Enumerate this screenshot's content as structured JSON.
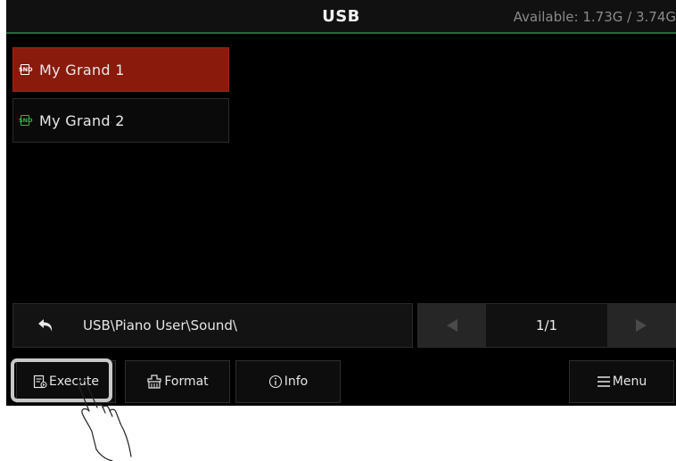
{
  "header": {
    "title": "USB",
    "available": "Available: 1.73G / 3.74G"
  },
  "files": [
    {
      "label": "My Grand 1",
      "tag": "SND",
      "selected": true
    },
    {
      "label": "My Grand 2",
      "tag": "SND",
      "selected": false
    }
  ],
  "path": {
    "value": "USB\\Piano User\\Sound\\"
  },
  "pager": {
    "page": "1/1"
  },
  "buttons": {
    "execute": "Execute",
    "format": "Format",
    "info": "Info",
    "menu": "Menu"
  },
  "colors": {
    "selected": "#8a1a0c",
    "accent_line": "#1f6b3a",
    "snd_icon_selected": "#ffffff",
    "snd_icon": "#2fb34a"
  },
  "icons": {
    "file": "snd-file-icon",
    "back": "back-arrow-icon",
    "prev": "triangle-left-icon",
    "next": "triangle-right-icon",
    "execute": "execute-icon",
    "format": "format-icon",
    "info": "info-icon",
    "menu": "hamburger-icon"
  }
}
